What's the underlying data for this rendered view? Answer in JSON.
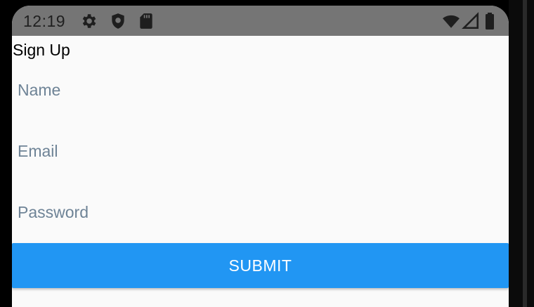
{
  "status_bar": {
    "time": "12:19",
    "left_icons": [
      "settings-icon",
      "shield-icon",
      "sd-card-icon"
    ],
    "right_icons": [
      "wifi-icon",
      "cell-signal-icon",
      "battery-icon"
    ],
    "background_color": "#757575"
  },
  "page": {
    "title": "Sign Up"
  },
  "form": {
    "fields": [
      {
        "label": "Name",
        "value": ""
      },
      {
        "label": "Email",
        "value": ""
      },
      {
        "label": "Password",
        "value": ""
      }
    ],
    "submit_label": "SUBMIT",
    "accent_color": "#2196f3",
    "label_color": "#6e8396"
  }
}
